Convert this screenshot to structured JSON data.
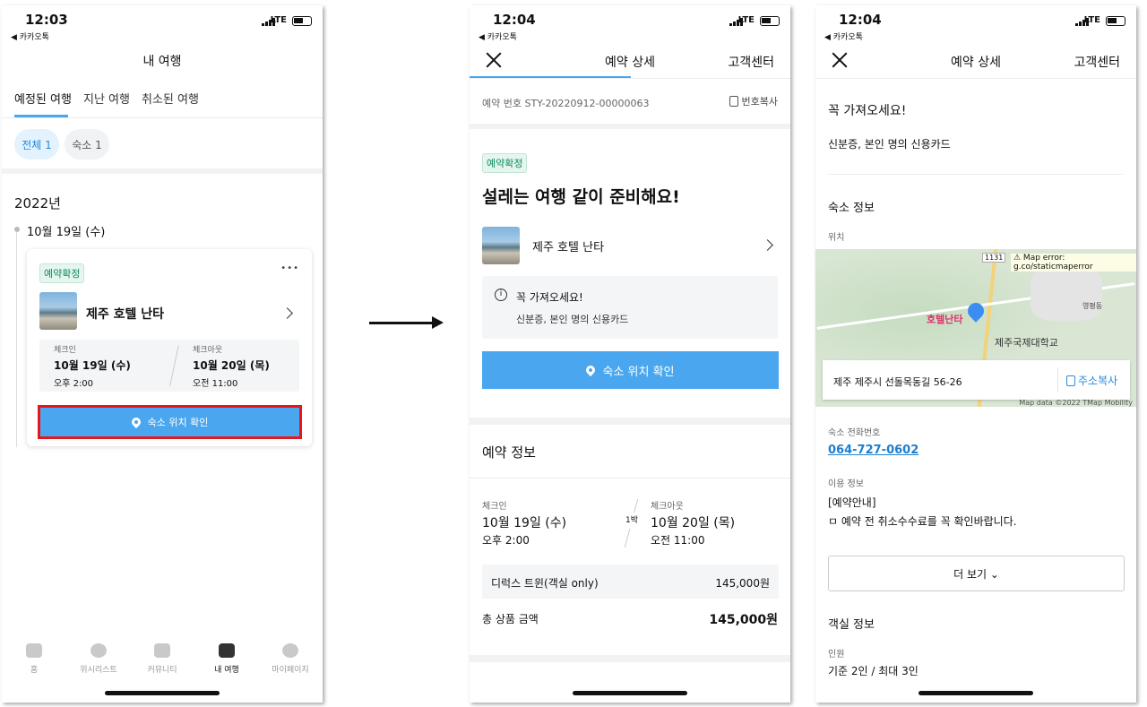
{
  "status1": {
    "time": "12:03",
    "back": "◀ 카카오톡",
    "net": "LTE"
  },
  "status2": {
    "time": "12:04",
    "back": "◀ 카카오톡",
    "net": "LTE"
  },
  "status3": {
    "time": "12:04",
    "back": "◀ 카카오톡",
    "net": "LTE"
  },
  "screen1": {
    "title": "내 여행",
    "tabs": [
      "예정된 여행",
      "지난 여행",
      "취소된 여행"
    ],
    "chips": [
      "전체 1",
      "숙소 1"
    ],
    "year": "2022년",
    "date": "10월 19일 (수)",
    "card": {
      "badge": "예약확정",
      "more": "•••",
      "hotel": "제주 호텔 난타",
      "checkin_label": "체크인",
      "checkin_date": "10월 19일 (수)",
      "checkin_time": "오후 2:00",
      "checkout_label": "체크아웃",
      "checkout_date": "10월 20일 (목)",
      "checkout_time": "오전 11:00",
      "location_button": "숙소 위치 확인"
    },
    "nav": [
      "홈",
      "위시리스트",
      "커뮤니티",
      "내 여행",
      "마이페이지"
    ],
    "highlight_color": "#e8161c"
  },
  "screen2": {
    "title": "예약 상세",
    "support": "고객센터",
    "booking_no": "예약 번호 STY-20220912-00000063",
    "copy_no": "번호복사",
    "badge": "예약확정",
    "headline": "설레는 여행 같이 준비해요!",
    "hotel": "제주 호텔 난타",
    "notice_title": "꼭 가져오세요!",
    "notice_body": "신분증, 본인 명의 신용카드",
    "location_button": "숙소 위치 확인",
    "section_title": "예약 정보",
    "checkin_label": "체크인",
    "checkin_date": "10월 19일 (수)",
    "checkin_time": "오후 2:00",
    "nights": "1박",
    "checkout_label": "체크아웃",
    "checkout_date": "10월 20일 (목)",
    "checkout_time": "오전 11:00",
    "room": "디럭스 트윈(객실 only)",
    "room_price": "145,000원",
    "total_label": "총 상품 금액",
    "total": "145,000원"
  },
  "screen3": {
    "title": "예약 상세",
    "support": "고객센터",
    "bring_title": "꼭 가져오세요!",
    "bring_body": "신분증, 본인 명의 신용카드",
    "info_title": "숙소 정보",
    "location_label": "위치",
    "map_error": "⚠ Map error: g.co/staticmaperror",
    "map_road": "1131",
    "map_hotel": "호텔난타",
    "map_school": "제주국제대학교",
    "map_area": "영평동",
    "map_footer": "Map data ©2022 TMap Mobility",
    "address": "제주 제주시 선돌목동길 56-26",
    "copy_address": "주소복사",
    "phone_label": "숙소 전화번호",
    "phone": "064-727-0602",
    "usage_label": "이용 정보",
    "usage_line1": "[예약안내]",
    "usage_line2": "ㅁ 예약 전 취소수수료를 꼭 확인바랍니다.",
    "more": "더 보기 ⌄",
    "room_title": "객실 정보",
    "people_label": "인원",
    "people": "기준 2인 / 최대 3인"
  }
}
